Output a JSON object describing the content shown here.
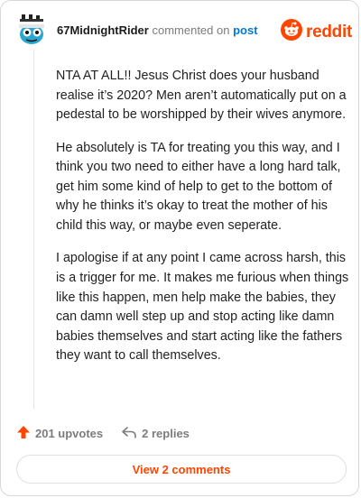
{
  "header": {
    "username": "67MidnightRider",
    "action_text": "commented on",
    "post_link": "post",
    "brand_name": "reddit"
  },
  "comment": {
    "paragraphs": [
      "NTA AT ALL!! Jesus Christ does your husband realise it’s 2020? Men aren’t automatically put on a pedestal to be worshipped by their wives anymore.",
      "He absolutely is TA for treating you this way, and I think you two need to either have a long hard talk, get him some kind of help to get to the bottom of why he thinks it’s okay to treat the mother of his child this way, or maybe even seperate.",
      "I apologise if at any point I came across harsh, this is a trigger for me. It makes me furious when things like this happen, men help make the babies, they can damn well step up and stop acting like damn babies themselves and start acting like the fathers they want to call themselves."
    ]
  },
  "actions": {
    "upvotes": "201 upvotes",
    "replies": "2 replies"
  },
  "footer": {
    "view_comments": "View 2 comments"
  },
  "colors": {
    "brand": "#ff4500",
    "link": "#0079d3",
    "muted": "#7c7c7c"
  },
  "icons": [
    "snoo-avatar-icon",
    "reddit-logo-icon",
    "upvote-arrow-icon",
    "reply-icon"
  ]
}
